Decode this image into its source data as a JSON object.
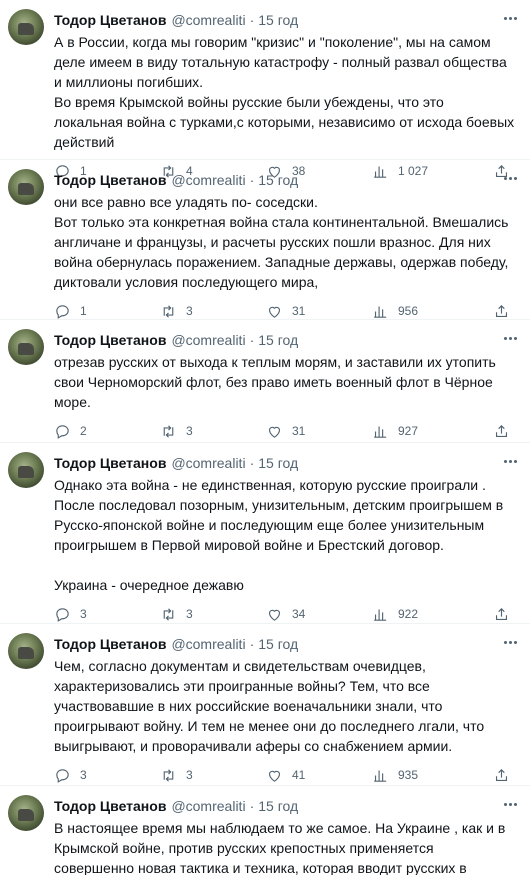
{
  "author": {
    "name": "Тодор Цветанов",
    "handle": "@comrealiti",
    "separator": "·"
  },
  "tweets": [
    {
      "time": "15 год",
      "text": "А в России, когда мы говорим \"кризис\" и \"поколение\", мы на самом деле имеем в виду тотальную катастрофу - полный развал общества и миллионы погибших.\nВо время Крымской войны русские были убеждены, что это локальная война с турками,с которыми, независимо от исхода боевых действий",
      "replies": "1",
      "retweets": "4",
      "likes": "38",
      "views": "1 027"
    },
    {
      "time": "15 год",
      "text": "они все равно все уладять  по- соседски.\nВот только эта конкретная война стала континентальной. Вмешались англичане и французы, и расчеты русских пошли вразнос. Для них война обернулась поражением. Западные державы, одержав победу, диктовали условия последующего мира,",
      "replies": "1",
      "retweets": "3",
      "likes": "31",
      "views": "956"
    },
    {
      "time": "15 год",
      "text": "отрезав русских от выхода к теплым морям, и заставили их утопить свои Черноморский флот, без право иметь военный флот в Чёрное море.",
      "replies": "2",
      "retweets": "3",
      "likes": "31",
      "views": "927"
    },
    {
      "time": "15 год",
      "text": "Однако эта война - не единственная, которую русские проиграли .\nПосле  последовал  позорным, унизительным, детским проигрышем в Русско-японской войне и последующим еще более унизительным проигрышем в Первой мировой войне и Брестский договор.\n\nУкраина - очередное дежавю",
      "replies": "3",
      "retweets": "3",
      "likes": "34",
      "views": "922"
    },
    {
      "time": "15 год",
      "text": "Чем, согласно документам и свидетельствам очевидцев, характеризовались эти проигранные войны? Тем, что все участвовавшие в них российские военачальники знали, что проигрывают войну. И тем не менее они до последнего лгали, что выигрывают, и проворачивали аферы со снабжением армии.",
      "replies": "3",
      "retweets": "3",
      "likes": "41",
      "views": "935"
    },
    {
      "time": "15 год",
      "text": "В настоящее время мы наблюдаем то же самое. На Украине , как и в Крымской войне, против русских крепостных применяется совершенно новая тактика и техника, которая вводит русских в ступор."
    }
  ],
  "icons": [
    "avatar",
    "more-icon",
    "reply-icon",
    "retweet-icon",
    "like-icon",
    "views-icon",
    "share-icon"
  ],
  "colors": {
    "text": "#0f1419",
    "secondary": "#536471",
    "divider": "#eff3f4"
  }
}
